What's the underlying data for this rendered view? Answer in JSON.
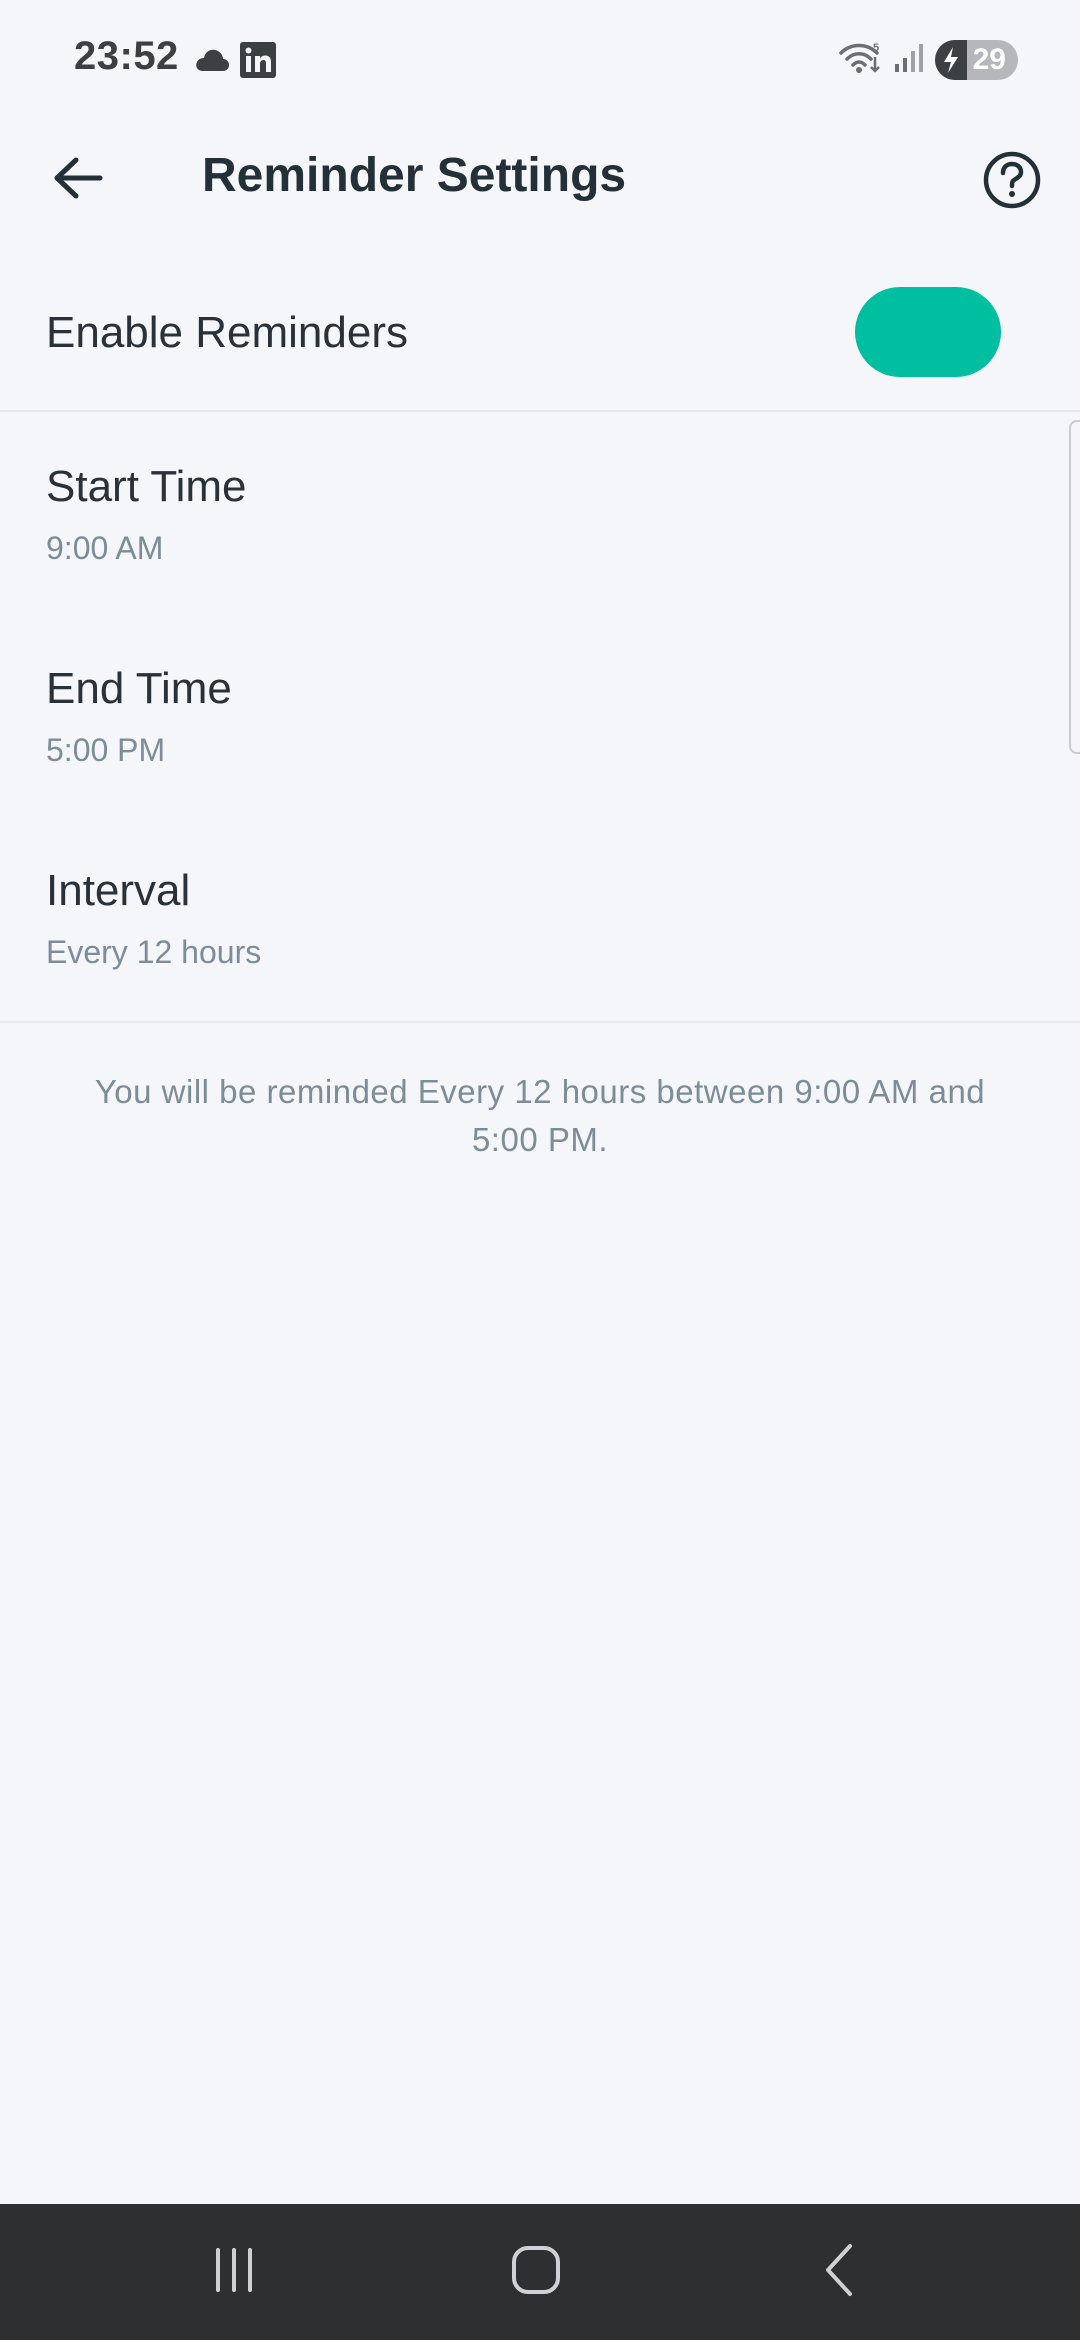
{
  "status_bar": {
    "time": "23:52",
    "battery_level": "29",
    "left_icons": [
      "cloud-icon",
      "linkedin-icon"
    ],
    "right_icons": [
      "wifi-icon",
      "signal-icon",
      "battery-charging-icon"
    ]
  },
  "app_bar": {
    "title": "Reminder Settings",
    "back_icon": "arrow-left-icon",
    "help_icon": "help-circle-icon"
  },
  "enable_reminders": {
    "label": "Enable Reminders",
    "enabled": true,
    "toggle_color": "#00bfa0"
  },
  "settings": [
    {
      "title": "Start Time",
      "value": "9:00 AM"
    },
    {
      "title": "End Time",
      "value": "5:00 PM"
    },
    {
      "title": "Interval",
      "value": "Every 12 hours"
    }
  ],
  "summary": "You will be reminded Every 12 hours between 9:00 AM and 5:00 PM.",
  "nav_bar": {
    "buttons": [
      "recent-apps-icon",
      "home-icon",
      "back-icon"
    ]
  }
}
